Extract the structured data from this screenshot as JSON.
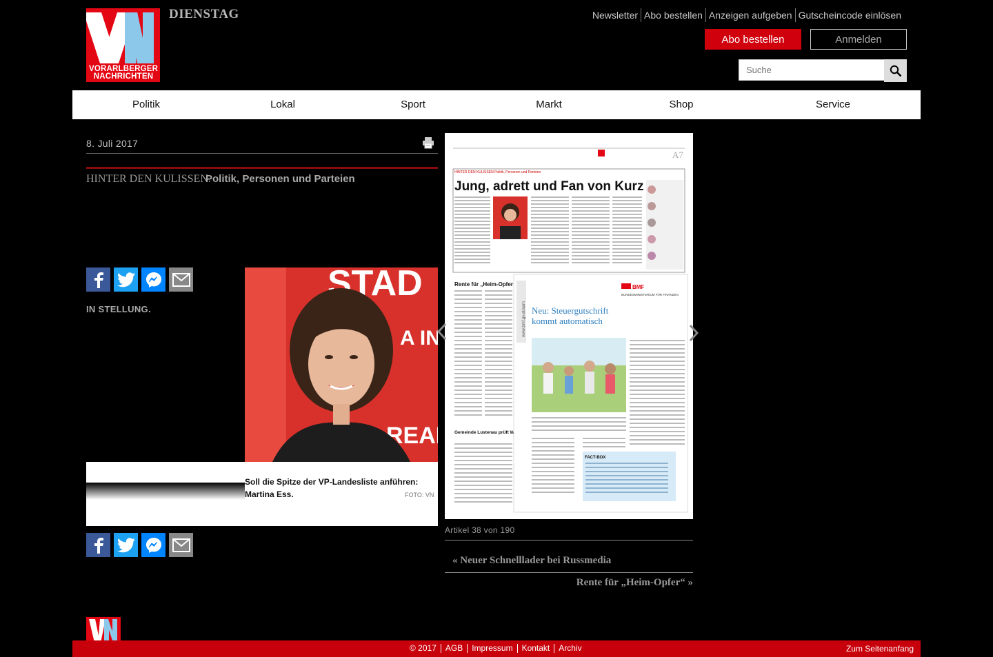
{
  "header": {
    "logo_line1": "VORARLBERGER",
    "logo_line2": "NACHRICHTEN",
    "weekday": "DIENSTAG",
    "top_links": [
      "Newsletter",
      "Abo bestellen",
      "Anzeigen aufgeben",
      "Gutscheincode einlösen"
    ],
    "abo_button": "Abo bestellen",
    "login_button": "Anmelden",
    "search_placeholder": "Suche"
  },
  "nav": {
    "items": [
      "Politik",
      "Lokal",
      "Sport",
      "Markt",
      "Shop",
      "Service"
    ]
  },
  "article": {
    "date": "8. Juli 2017",
    "kicker": "HINTER DEN KULISSEN.",
    "subtitle": "Politik, Personen und Parteien",
    "section_label": "IN STELLUNG.",
    "photo_text_top": "STAD",
    "photo_text_mid": "A IN",
    "photo_text_bottom": "READY",
    "caption": "Soll die Spitze der VP-Landesliste anführen: Martina Ess.",
    "credit": "FOTO: VN"
  },
  "epaper": {
    "page_no": "A7",
    "headline": "Jung, adrett und Fan von Kurz",
    "section": "HINTER DEN KULISSEN  Politik, Personen und Parteien",
    "rente_title": "Rente für „Heim-Opfer“",
    "lustenau_title": "Gemeinde Lustenau prüft Wechsel zur Papiertonne",
    "ad_brand": "BMF",
    "ad_ministry": "BUNDESMINISTERIUM FÜR FINANZEN",
    "ad_title_1": "Neu: Steuergutschrift",
    "ad_title_2": "kommt automatisch",
    "fact_box": "FACT-BOX",
    "ad_url": "www.bmf.gv.at/aam"
  },
  "pager": {
    "count": "Artikel 38 von 190",
    "prev_label": "Neuer Schnelllader bei Russmedia",
    "next_label": "Rente für „Heim-Opfer“",
    "prev_marker": "«",
    "next_marker": "»"
  },
  "footer": {
    "links": [
      "© 2017",
      "AGB",
      "Impressum",
      "Kontakt",
      "Archiv"
    ],
    "to_top": "Zum Seitenanfang"
  },
  "colors": {
    "brand_red": "#e30613",
    "logo_blue": "#8cc8ea",
    "facebook": "#3b5998",
    "twitter": "#1da1f2",
    "messenger": "#0084ff"
  }
}
